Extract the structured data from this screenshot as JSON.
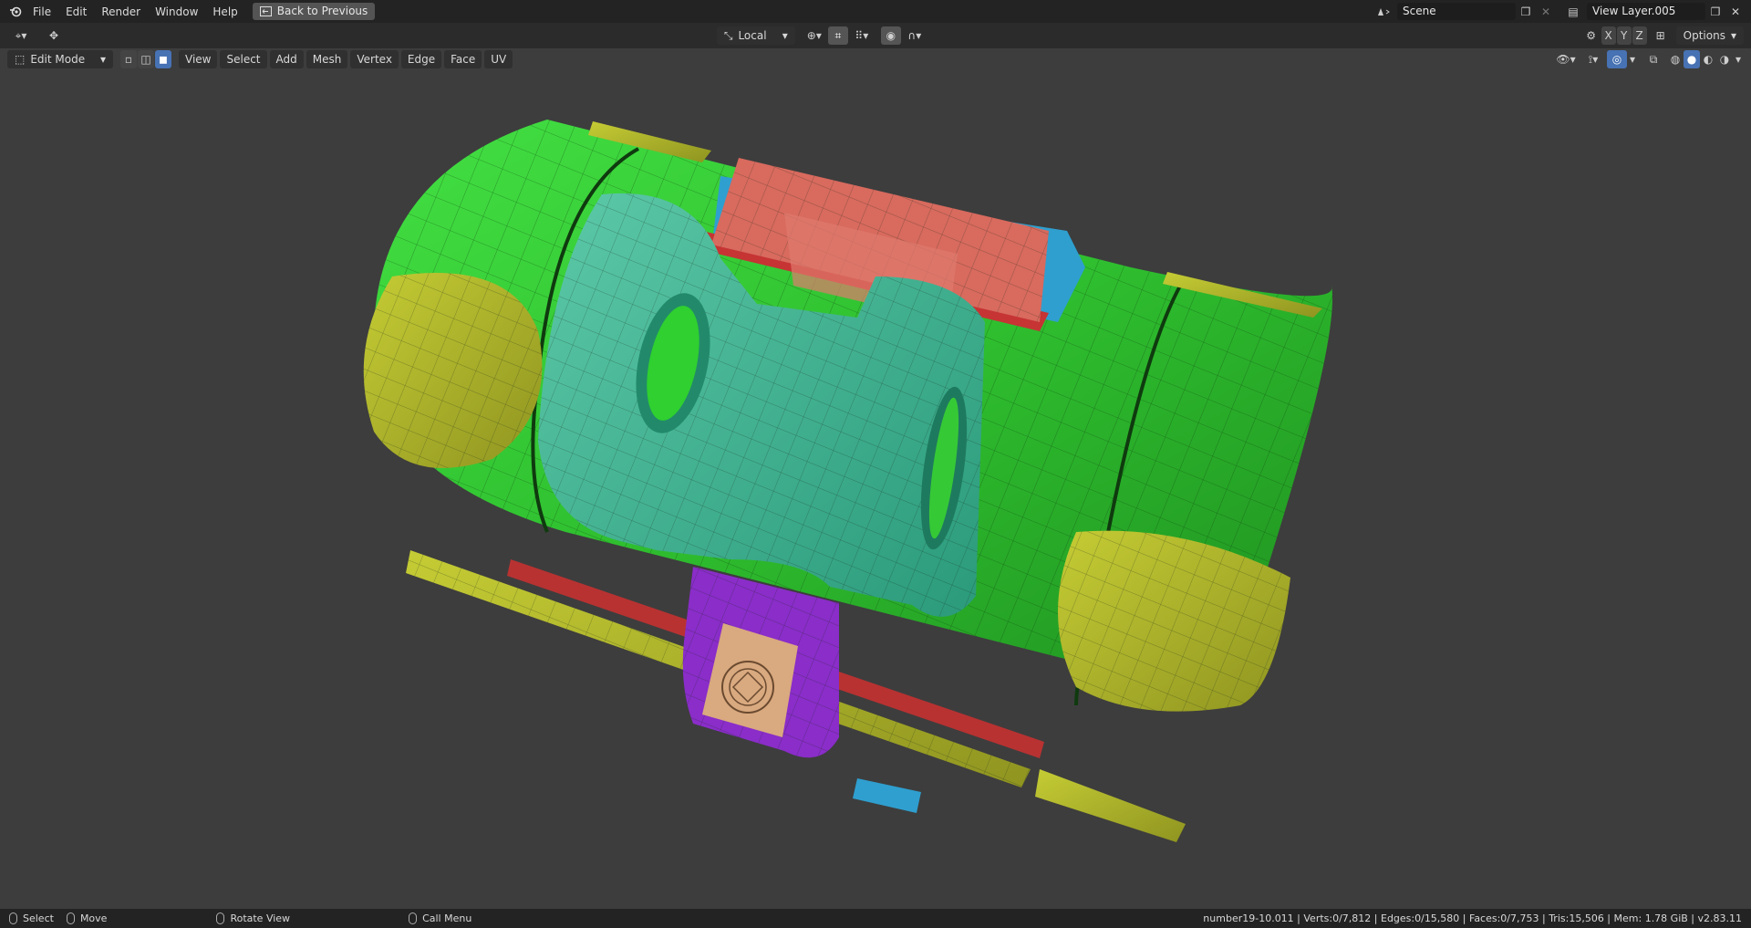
{
  "topbar": {
    "menus": [
      "File",
      "Edit",
      "Render",
      "Window",
      "Help"
    ],
    "back_button": "Back to Previous",
    "scene": "Scene",
    "view_layer": "View Layer.005"
  },
  "toolrow": {
    "orientation": "Local",
    "options": "Options",
    "axes": [
      "X",
      "Y",
      "Z"
    ]
  },
  "header": {
    "mode": "Edit Mode",
    "menus": [
      "View",
      "Select",
      "Add",
      "Mesh",
      "Vertex",
      "Edge",
      "Face",
      "UV"
    ]
  },
  "statusbar": {
    "select": "Select",
    "move": "Move",
    "rotate": "Rotate View",
    "call_menu": "Call Menu",
    "stats": "number19-10.011 | Verts:0/7,812 | Edges:0/15,580 | Faces:0/7,753 | Tris:15,506 | Mem: 1.78 GiB | v2.83.11"
  },
  "colors": {
    "green": "#2fc42f",
    "yellow": "#b7bd2a",
    "teal": "#3fb896",
    "red": "#d86a5e",
    "blue": "#2f9fcf",
    "purple": "#8a2dc9",
    "tan": "#d9a97f"
  }
}
